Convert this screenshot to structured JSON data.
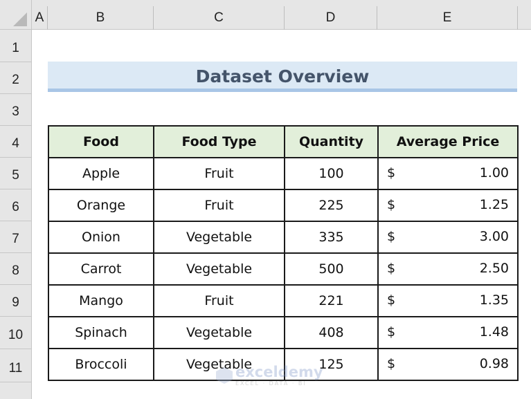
{
  "sheet": {
    "columns": [
      "A",
      "B",
      "C",
      "D",
      "E"
    ],
    "rows": [
      "1",
      "2",
      "3",
      "4",
      "5",
      "6",
      "7",
      "8",
      "9",
      "10",
      "11"
    ]
  },
  "title": "Dataset Overview",
  "table": {
    "headers": [
      "Food",
      "Food Type",
      "Quantity",
      "Average Price"
    ],
    "rows": [
      {
        "food": "Apple",
        "type": "Fruit",
        "quantity": "100",
        "currency": "$",
        "price": "1.00"
      },
      {
        "food": "Orange",
        "type": "Fruit",
        "quantity": "225",
        "currency": "$",
        "price": "1.25"
      },
      {
        "food": "Onion",
        "type": "Vegetable",
        "quantity": "335",
        "currency": "$",
        "price": "3.00"
      },
      {
        "food": "Carrot",
        "type": "Vegetable",
        "quantity": "500",
        "currency": "$",
        "price": "2.50"
      },
      {
        "food": "Mango",
        "type": "Fruit",
        "quantity": "221",
        "currency": "$",
        "price": "1.35"
      },
      {
        "food": "Spinach",
        "type": "Vegetable",
        "quantity": "408",
        "currency": "$",
        "price": "1.48"
      },
      {
        "food": "Broccoli",
        "type": "Vegetable",
        "quantity": "125",
        "currency": "$",
        "price": "0.98"
      }
    ]
  },
  "watermark": {
    "name": "exceldemy",
    "tagline": "EXCEL · DATA · BI"
  },
  "colors": {
    "title_fill": "#dce9f5",
    "title_text": "#44546a",
    "header_fill": "#e2efda"
  }
}
